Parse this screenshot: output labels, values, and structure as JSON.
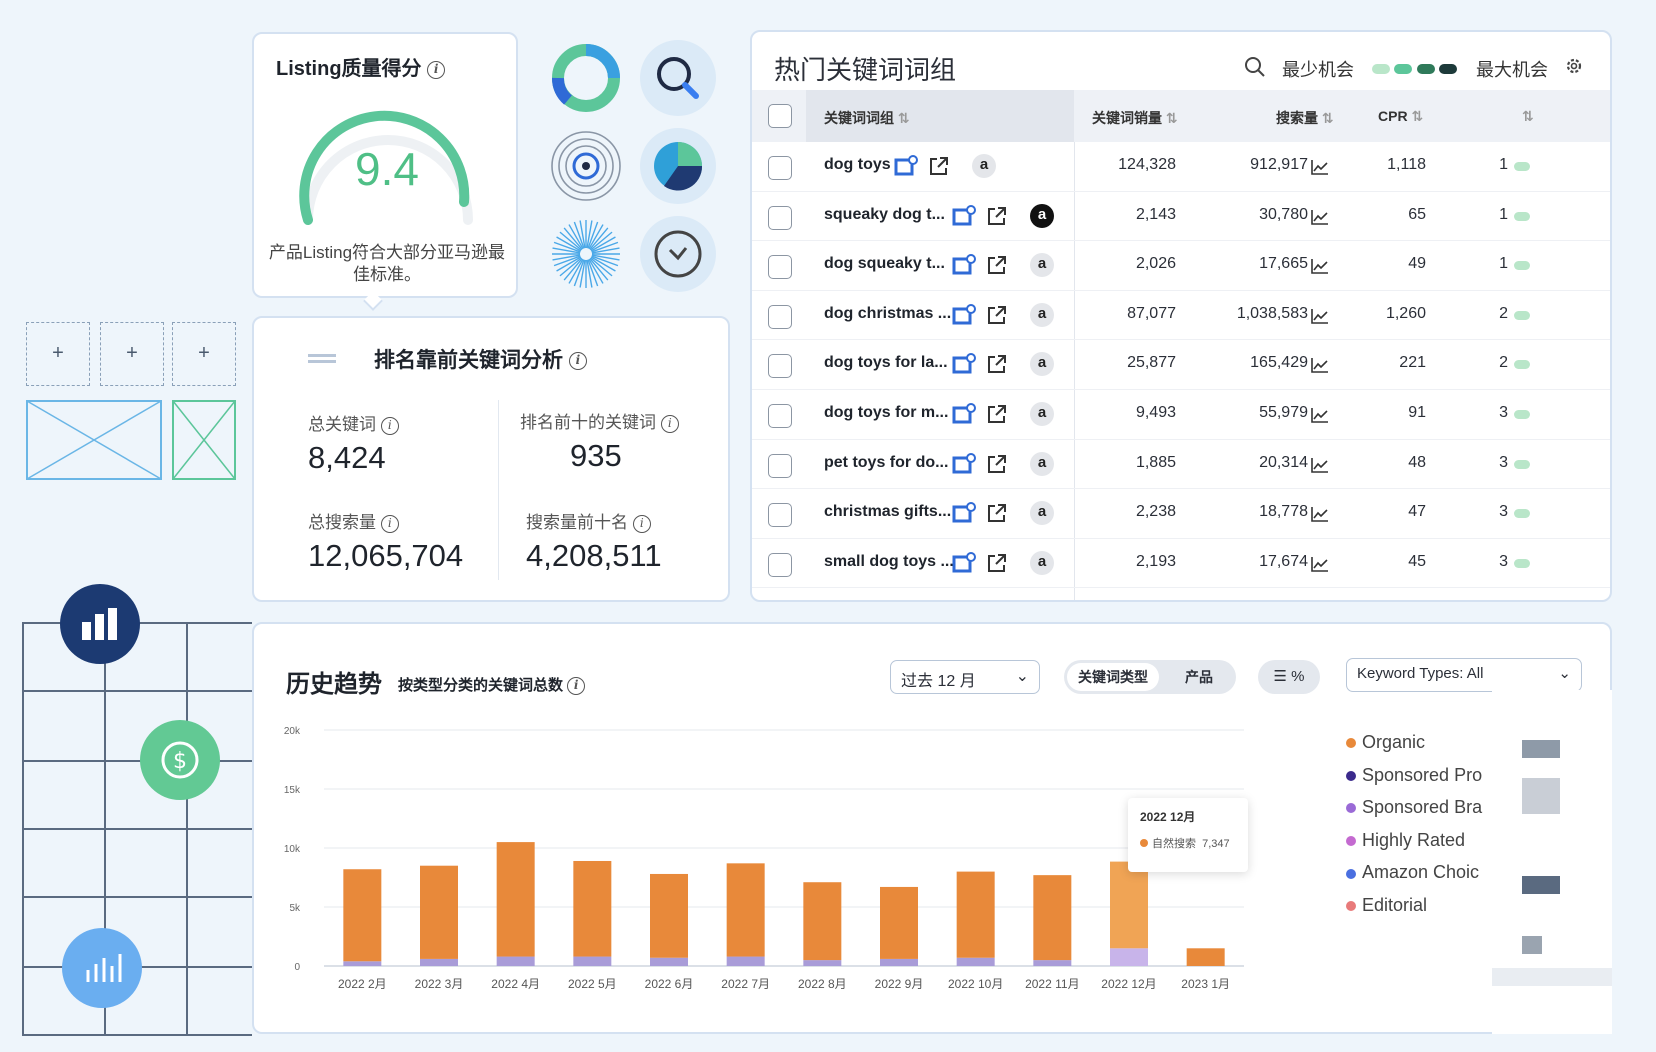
{
  "quality": {
    "title": "Listing质量得分",
    "score": "9.4",
    "description": "产品Listing符合大部分亚马逊最佳标准。"
  },
  "keyword_analysis": {
    "title": "排名靠前关键词分析",
    "stats": [
      {
        "label": "总关键词",
        "value": "8,424"
      },
      {
        "label": "排名前十的关键词",
        "value": "935"
      },
      {
        "label": "总搜索量",
        "value": "12,065,704"
      },
      {
        "label": "搜索量前十名",
        "value": "4,208,511"
      }
    ]
  },
  "table": {
    "title": "热门关键词词组",
    "opportunity_min": "最少机会",
    "opportunity_max": "最大机会",
    "headers": [
      "关键词词组",
      "关键词销量",
      "搜索量",
      "CPR"
    ],
    "rows": [
      {
        "keyword": "dog toys",
        "sales": "124,328",
        "search": "912,917",
        "cpr": "1,118",
        "rank": "1",
        "amazon": "a",
        "amazon_dark": false
      },
      {
        "keyword": "squeaky dog t...",
        "sales": "2,143",
        "search": "30,780",
        "cpr": "65",
        "rank": "1",
        "amazon": "a",
        "amazon_dark": true
      },
      {
        "keyword": "dog squeaky t...",
        "sales": "2,026",
        "search": "17,665",
        "cpr": "49",
        "rank": "1",
        "amazon": "a",
        "amazon_dark": false
      },
      {
        "keyword": "dog christmas ...",
        "sales": "87,077",
        "search": "1,038,583",
        "cpr": "1,260",
        "rank": "2",
        "amazon": "a",
        "amazon_dark": false
      },
      {
        "keyword": "dog toys for la...",
        "sales": "25,877",
        "search": "165,429",
        "cpr": "221",
        "rank": "2",
        "amazon": "a",
        "amazon_dark": false
      },
      {
        "keyword": "dog toys for m...",
        "sales": "9,493",
        "search": "55,979",
        "cpr": "91",
        "rank": "3",
        "amazon": "a",
        "amazon_dark": false
      },
      {
        "keyword": "pet toys for do...",
        "sales": "1,885",
        "search": "20,314",
        "cpr": "48",
        "rank": "3",
        "amazon": "a",
        "amazon_dark": false
      },
      {
        "keyword": "christmas gifts...",
        "sales": "2,238",
        "search": "18,778",
        "cpr": "47",
        "rank": "3",
        "amazon": "a",
        "amazon_dark": false
      },
      {
        "keyword": "small dog toys ...",
        "sales": "2,193",
        "search": "17,674",
        "cpr": "45",
        "rank": "3",
        "amazon": "a",
        "amazon_dark": false
      }
    ]
  },
  "trend": {
    "title": "历史趋势",
    "subtitle": "按类型分类的关键词总数",
    "period_select": "过去 12 月",
    "toggle_a": "关键词类型",
    "toggle_b": "产品",
    "keyword_types": "Keyword Types: All",
    "tooltip_title": "2022 12月",
    "tooltip_label": "自然搜索",
    "tooltip_value": "7,347",
    "legend": [
      {
        "name": "Organic",
        "color": "#e8893a"
      },
      {
        "name": "Sponsored Pro",
        "color": "#3b2a8c"
      },
      {
        "name": "Sponsored Bra",
        "color": "#9a6ad6"
      },
      {
        "name": "Highly Rated",
        "color": "#c46ad0"
      },
      {
        "name": "Amazon Choic",
        "color": "#4a6fe0"
      },
      {
        "name": "Editorial",
        "color": "#e87a7a"
      }
    ]
  },
  "chart_data": {
    "type": "bar",
    "categories": [
      "2022 2月",
      "2022 3月",
      "2022 4月",
      "2022 5月",
      "2022 6月",
      "2022 7月",
      "2022 8月",
      "2022 9月",
      "2022 10月",
      "2022 11月",
      "2022 12月",
      "2023 1月"
    ],
    "series": [
      {
        "name": "Organic",
        "values": [
          7800,
          7900,
          9700,
          8100,
          7100,
          7900,
          6600,
          6100,
          7300,
          7200,
          7347,
          1500
        ]
      },
      {
        "name": "Sponsored Bra",
        "values": [
          400,
          600,
          800,
          800,
          700,
          800,
          500,
          600,
          700,
          500,
          1500,
          0
        ]
      }
    ],
    "yticks": [
      "0",
      "5k",
      "10k",
      "15k",
      "20k"
    ],
    "ylim": [
      0,
      20000
    ]
  }
}
